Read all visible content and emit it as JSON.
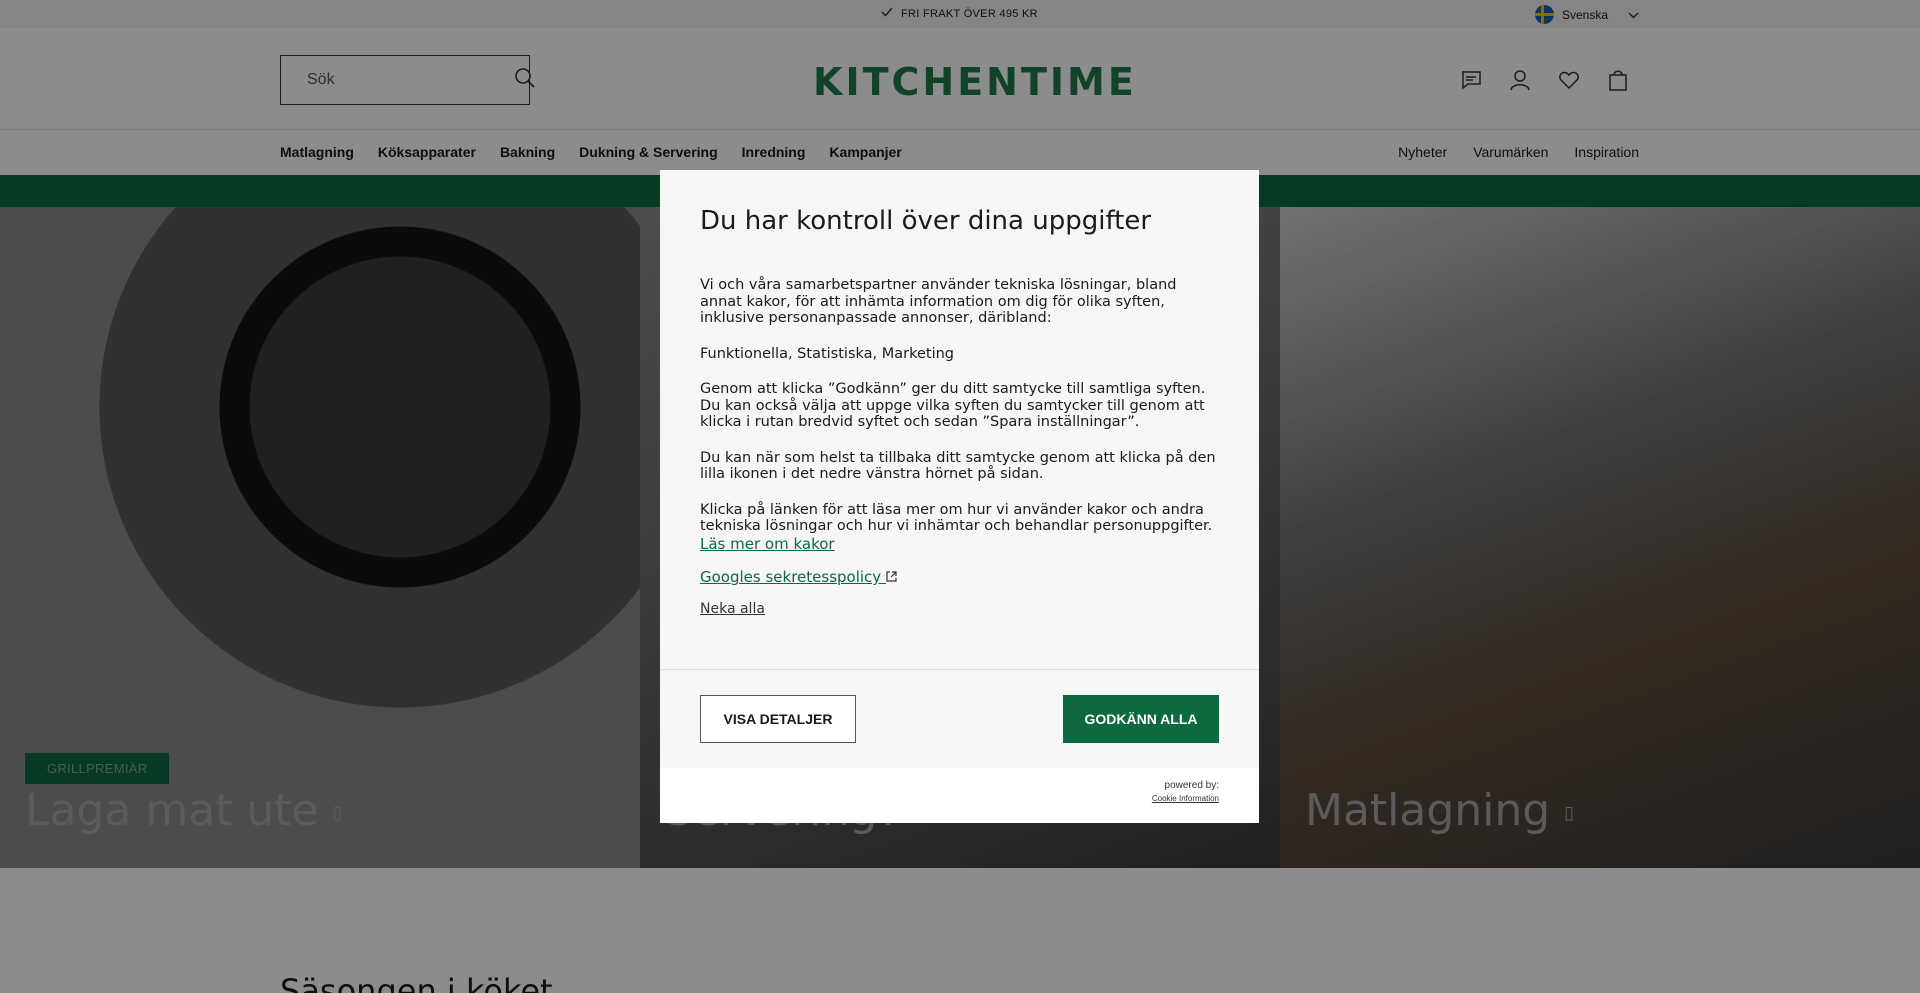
{
  "topbar": {
    "promo": "FRI FRAKT ÖVER 495 KR",
    "language": "Svenska"
  },
  "header": {
    "search_placeholder": "Sök",
    "logo": "KITCHENTIME"
  },
  "nav": {
    "left": [
      "Matlagning",
      "Köksapparater",
      "Bakning",
      "Dukning & Servering",
      "Inredning",
      "Kampanjer"
    ],
    "right": [
      "Nyheter",
      "Varumärken",
      "Inspiration"
    ]
  },
  "hero": {
    "panels": [
      {
        "tag": "GRILLPREMIÄR",
        "title": "Laga mat ute"
      },
      {
        "tag": "",
        "title": "Servering?"
      },
      {
        "tag": "",
        "title": "Matlagning"
      }
    ]
  },
  "below": {
    "section_title": "Säsongen i köket"
  },
  "modal": {
    "title": "Du har kontroll över dina uppgifter",
    "paragraphs": [
      "Vi och våra samarbetspartner använder tekniska lösningar, bland annat kakor, för att inhämta information om dig för olika syften, inklusive personanpassade annonser, däribland:",
      "Funktionella, Statistiska, Marketing",
      "Genom att klicka ”Godkänn” ger du ditt samtycke till samtliga syften. Du kan också välja att uppge vilka syften du samtycker till genom att klicka i rutan bredvid syftet och sedan ”Spara inställningar”.",
      "Du kan när som helst ta tillbaka ditt samtycke genom att klicka på den lilla ikonen i det nedre vänstra hörnet på sidan.",
      "Klicka på länken för att läsa mer om hur vi använder kakor och andra tekniska lösningar och hur vi inhämtar och behandlar personuppgifter."
    ],
    "link_cookies": "Läs mer om kakor",
    "link_google": "Googles sekretesspolicy",
    "link_deny": "Neka alla",
    "btn_details": "VISA DETALJER",
    "btn_accept": "GODKÄNN ALLA",
    "powered_by": "powered by:",
    "powered_link": "Cookie Information"
  },
  "icons": [
    "check-icon",
    "flag-sweden-icon",
    "chevron-down-icon",
    "search-icon",
    "chat-icon",
    "user-icon",
    "heart-icon",
    "bag-icon",
    "external-link-icon"
  ],
  "colors": {
    "brand_green": "#0c6a3e",
    "logo_green": "#1f7a4c"
  }
}
